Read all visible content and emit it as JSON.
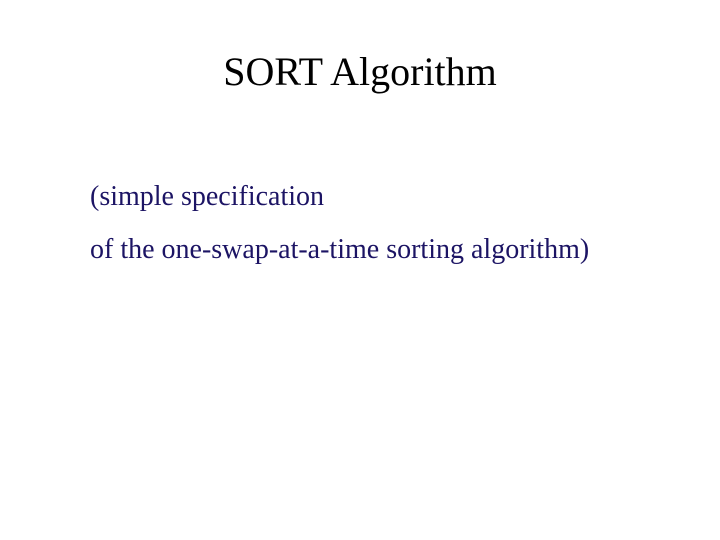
{
  "title": "SORT Algorithm",
  "body": {
    "line1": "(simple specification",
    "line2": "of the one-swap-at-a-time sorting algorithm)"
  }
}
